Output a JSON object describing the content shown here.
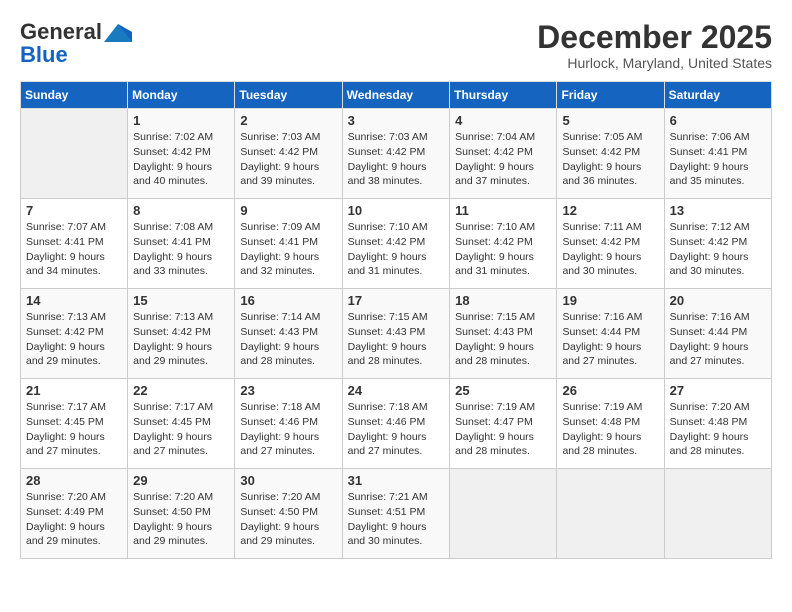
{
  "header": {
    "logo_general": "General",
    "logo_blue": "Blue",
    "title": "December 2025",
    "subtitle": "Hurlock, Maryland, United States"
  },
  "weekdays": [
    "Sunday",
    "Monday",
    "Tuesday",
    "Wednesday",
    "Thursday",
    "Friday",
    "Saturday"
  ],
  "weeks": [
    [
      {
        "day": "",
        "empty": true
      },
      {
        "day": "1",
        "sunrise": "7:02 AM",
        "sunset": "4:42 PM",
        "daylight": "9 hours and 40 minutes."
      },
      {
        "day": "2",
        "sunrise": "7:03 AM",
        "sunset": "4:42 PM",
        "daylight": "9 hours and 39 minutes."
      },
      {
        "day": "3",
        "sunrise": "7:03 AM",
        "sunset": "4:42 PM",
        "daylight": "9 hours and 38 minutes."
      },
      {
        "day": "4",
        "sunrise": "7:04 AM",
        "sunset": "4:42 PM",
        "daylight": "9 hours and 37 minutes."
      },
      {
        "day": "5",
        "sunrise": "7:05 AM",
        "sunset": "4:42 PM",
        "daylight": "9 hours and 36 minutes."
      },
      {
        "day": "6",
        "sunrise": "7:06 AM",
        "sunset": "4:41 PM",
        "daylight": "9 hours and 35 minutes."
      }
    ],
    [
      {
        "day": "7",
        "sunrise": "7:07 AM",
        "sunset": "4:41 PM",
        "daylight": "9 hours and 34 minutes."
      },
      {
        "day": "8",
        "sunrise": "7:08 AM",
        "sunset": "4:41 PM",
        "daylight": "9 hours and 33 minutes."
      },
      {
        "day": "9",
        "sunrise": "7:09 AM",
        "sunset": "4:41 PM",
        "daylight": "9 hours and 32 minutes."
      },
      {
        "day": "10",
        "sunrise": "7:10 AM",
        "sunset": "4:42 PM",
        "daylight": "9 hours and 31 minutes."
      },
      {
        "day": "11",
        "sunrise": "7:10 AM",
        "sunset": "4:42 PM",
        "daylight": "9 hours and 31 minutes."
      },
      {
        "day": "12",
        "sunrise": "7:11 AM",
        "sunset": "4:42 PM",
        "daylight": "9 hours and 30 minutes."
      },
      {
        "day": "13",
        "sunrise": "7:12 AM",
        "sunset": "4:42 PM",
        "daylight": "9 hours and 30 minutes."
      }
    ],
    [
      {
        "day": "14",
        "sunrise": "7:13 AM",
        "sunset": "4:42 PM",
        "daylight": "9 hours and 29 minutes."
      },
      {
        "day": "15",
        "sunrise": "7:13 AM",
        "sunset": "4:42 PM",
        "daylight": "9 hours and 29 minutes."
      },
      {
        "day": "16",
        "sunrise": "7:14 AM",
        "sunset": "4:43 PM",
        "daylight": "9 hours and 28 minutes."
      },
      {
        "day": "17",
        "sunrise": "7:15 AM",
        "sunset": "4:43 PM",
        "daylight": "9 hours and 28 minutes."
      },
      {
        "day": "18",
        "sunrise": "7:15 AM",
        "sunset": "4:43 PM",
        "daylight": "9 hours and 28 minutes."
      },
      {
        "day": "19",
        "sunrise": "7:16 AM",
        "sunset": "4:44 PM",
        "daylight": "9 hours and 27 minutes."
      },
      {
        "day": "20",
        "sunrise": "7:16 AM",
        "sunset": "4:44 PM",
        "daylight": "9 hours and 27 minutes."
      }
    ],
    [
      {
        "day": "21",
        "sunrise": "7:17 AM",
        "sunset": "4:45 PM",
        "daylight": "9 hours and 27 minutes."
      },
      {
        "day": "22",
        "sunrise": "7:17 AM",
        "sunset": "4:45 PM",
        "daylight": "9 hours and 27 minutes."
      },
      {
        "day": "23",
        "sunrise": "7:18 AM",
        "sunset": "4:46 PM",
        "daylight": "9 hours and 27 minutes."
      },
      {
        "day": "24",
        "sunrise": "7:18 AM",
        "sunset": "4:46 PM",
        "daylight": "9 hours and 27 minutes."
      },
      {
        "day": "25",
        "sunrise": "7:19 AM",
        "sunset": "4:47 PM",
        "daylight": "9 hours and 28 minutes."
      },
      {
        "day": "26",
        "sunrise": "7:19 AM",
        "sunset": "4:48 PM",
        "daylight": "9 hours and 28 minutes."
      },
      {
        "day": "27",
        "sunrise": "7:20 AM",
        "sunset": "4:48 PM",
        "daylight": "9 hours and 28 minutes."
      }
    ],
    [
      {
        "day": "28",
        "sunrise": "7:20 AM",
        "sunset": "4:49 PM",
        "daylight": "9 hours and 29 minutes."
      },
      {
        "day": "29",
        "sunrise": "7:20 AM",
        "sunset": "4:50 PM",
        "daylight": "9 hours and 29 minutes."
      },
      {
        "day": "30",
        "sunrise": "7:20 AM",
        "sunset": "4:50 PM",
        "daylight": "9 hours and 29 minutes."
      },
      {
        "day": "31",
        "sunrise": "7:21 AM",
        "sunset": "4:51 PM",
        "daylight": "9 hours and 30 minutes."
      },
      {
        "day": "",
        "empty": true
      },
      {
        "day": "",
        "empty": true
      },
      {
        "day": "",
        "empty": true
      }
    ]
  ]
}
